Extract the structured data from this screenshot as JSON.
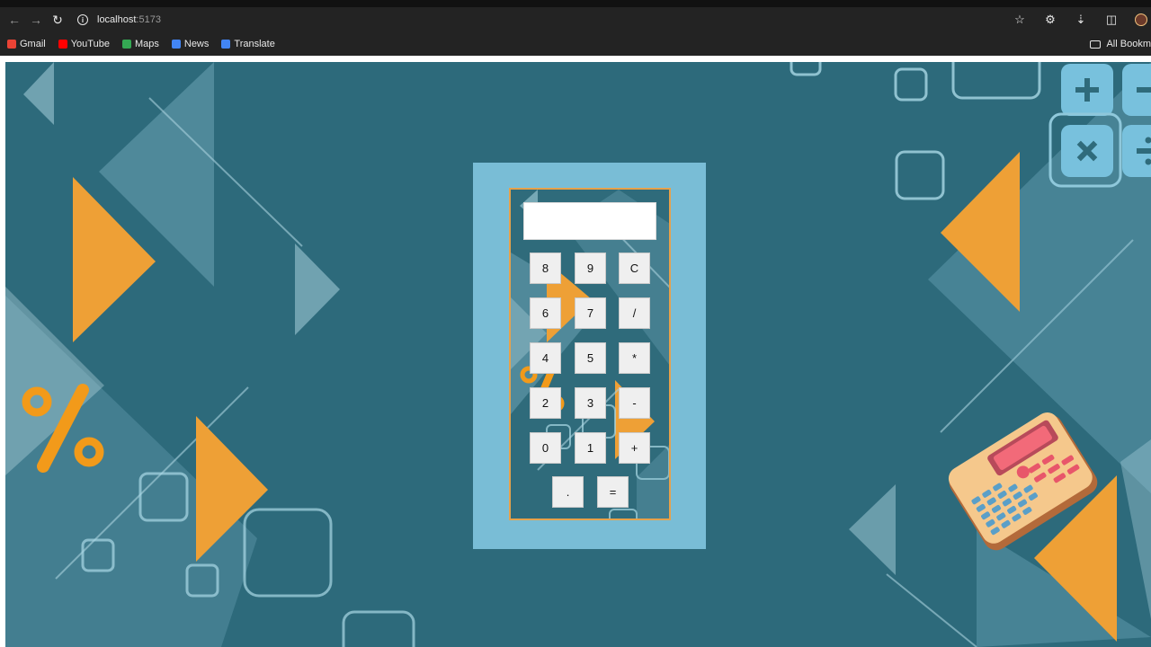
{
  "browser": {
    "url_host": "localhost",
    "url_port": ":5173",
    "bookmarks": [
      {
        "label": "Gmail",
        "color": "#ea4335"
      },
      {
        "label": "YouTube",
        "color": "#ff0000"
      },
      {
        "label": "Maps",
        "color": "#34a853"
      },
      {
        "label": "News",
        "color": "#4285f4"
      },
      {
        "label": "Translate",
        "color": "#4285f4"
      }
    ],
    "all_bookmarks_label": "All Bookm"
  },
  "calculator": {
    "display_value": "",
    "keys": {
      "k8": "8",
      "k9": "9",
      "kc": "C",
      "k6": "6",
      "k7": "7",
      "kdiv": "/",
      "k4": "4",
      "k5": "5",
      "kmul": "*",
      "k2": "2",
      "k3": "3",
      "ksub": "-",
      "k0": "0",
      "k1": "1",
      "kadd": "+",
      "kdot": ".",
      "keq": "="
    }
  },
  "theme": {
    "background": "#2d6a7b",
    "frame": "#79bdd6",
    "accent": "#eea036"
  }
}
